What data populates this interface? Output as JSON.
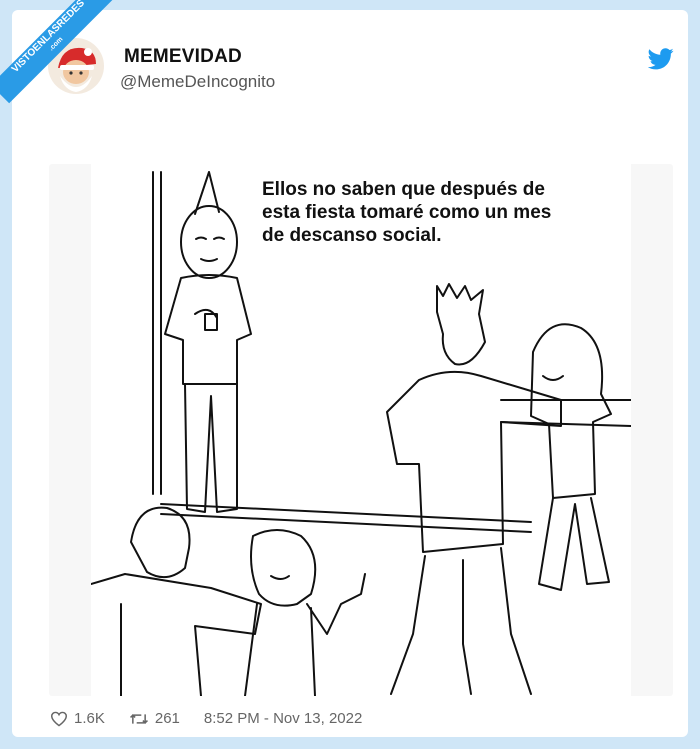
{
  "watermark": {
    "line1": "VISTOENLASREDES",
    "line2": ".com"
  },
  "tweet": {
    "author_name": "MEMEVIDAD",
    "author_handle": "@MemeDeIncognito",
    "icon": "twitter-bird-icon",
    "meme_caption": "Ellos no saben que después de esta fiesta tomaré como un mes de descanso social.",
    "likes": "1.6K",
    "retweets": "261",
    "timestamp": "8:52 PM - Nov 13, 2022"
  },
  "colors": {
    "background": "#cfe6f7",
    "twitter_blue": "#1d9bf0",
    "ribbon": "#2a9be6"
  }
}
